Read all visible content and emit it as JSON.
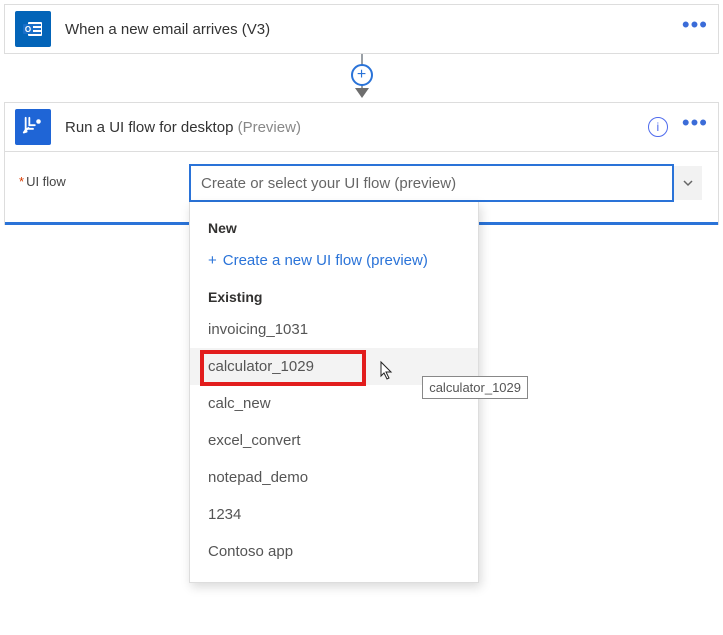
{
  "trigger": {
    "title": "When a new email arrives (V3)"
  },
  "action": {
    "title": "Run a UI flow for desktop ",
    "preview": "(Preview)"
  },
  "field": {
    "label": "UI flow",
    "placeholder": "Create or select your UI flow (preview)"
  },
  "dropdown": {
    "new_label": "New",
    "create_label": "Create a new UI flow (preview)",
    "existing_label": "Existing",
    "items": [
      "invoicing_1031",
      "calculator_1029",
      "calc_new",
      "excel_convert",
      "notepad_demo",
      "1234",
      "Contoso app"
    ],
    "highlighted_index": 1,
    "tooltip": "calculator_1029"
  }
}
